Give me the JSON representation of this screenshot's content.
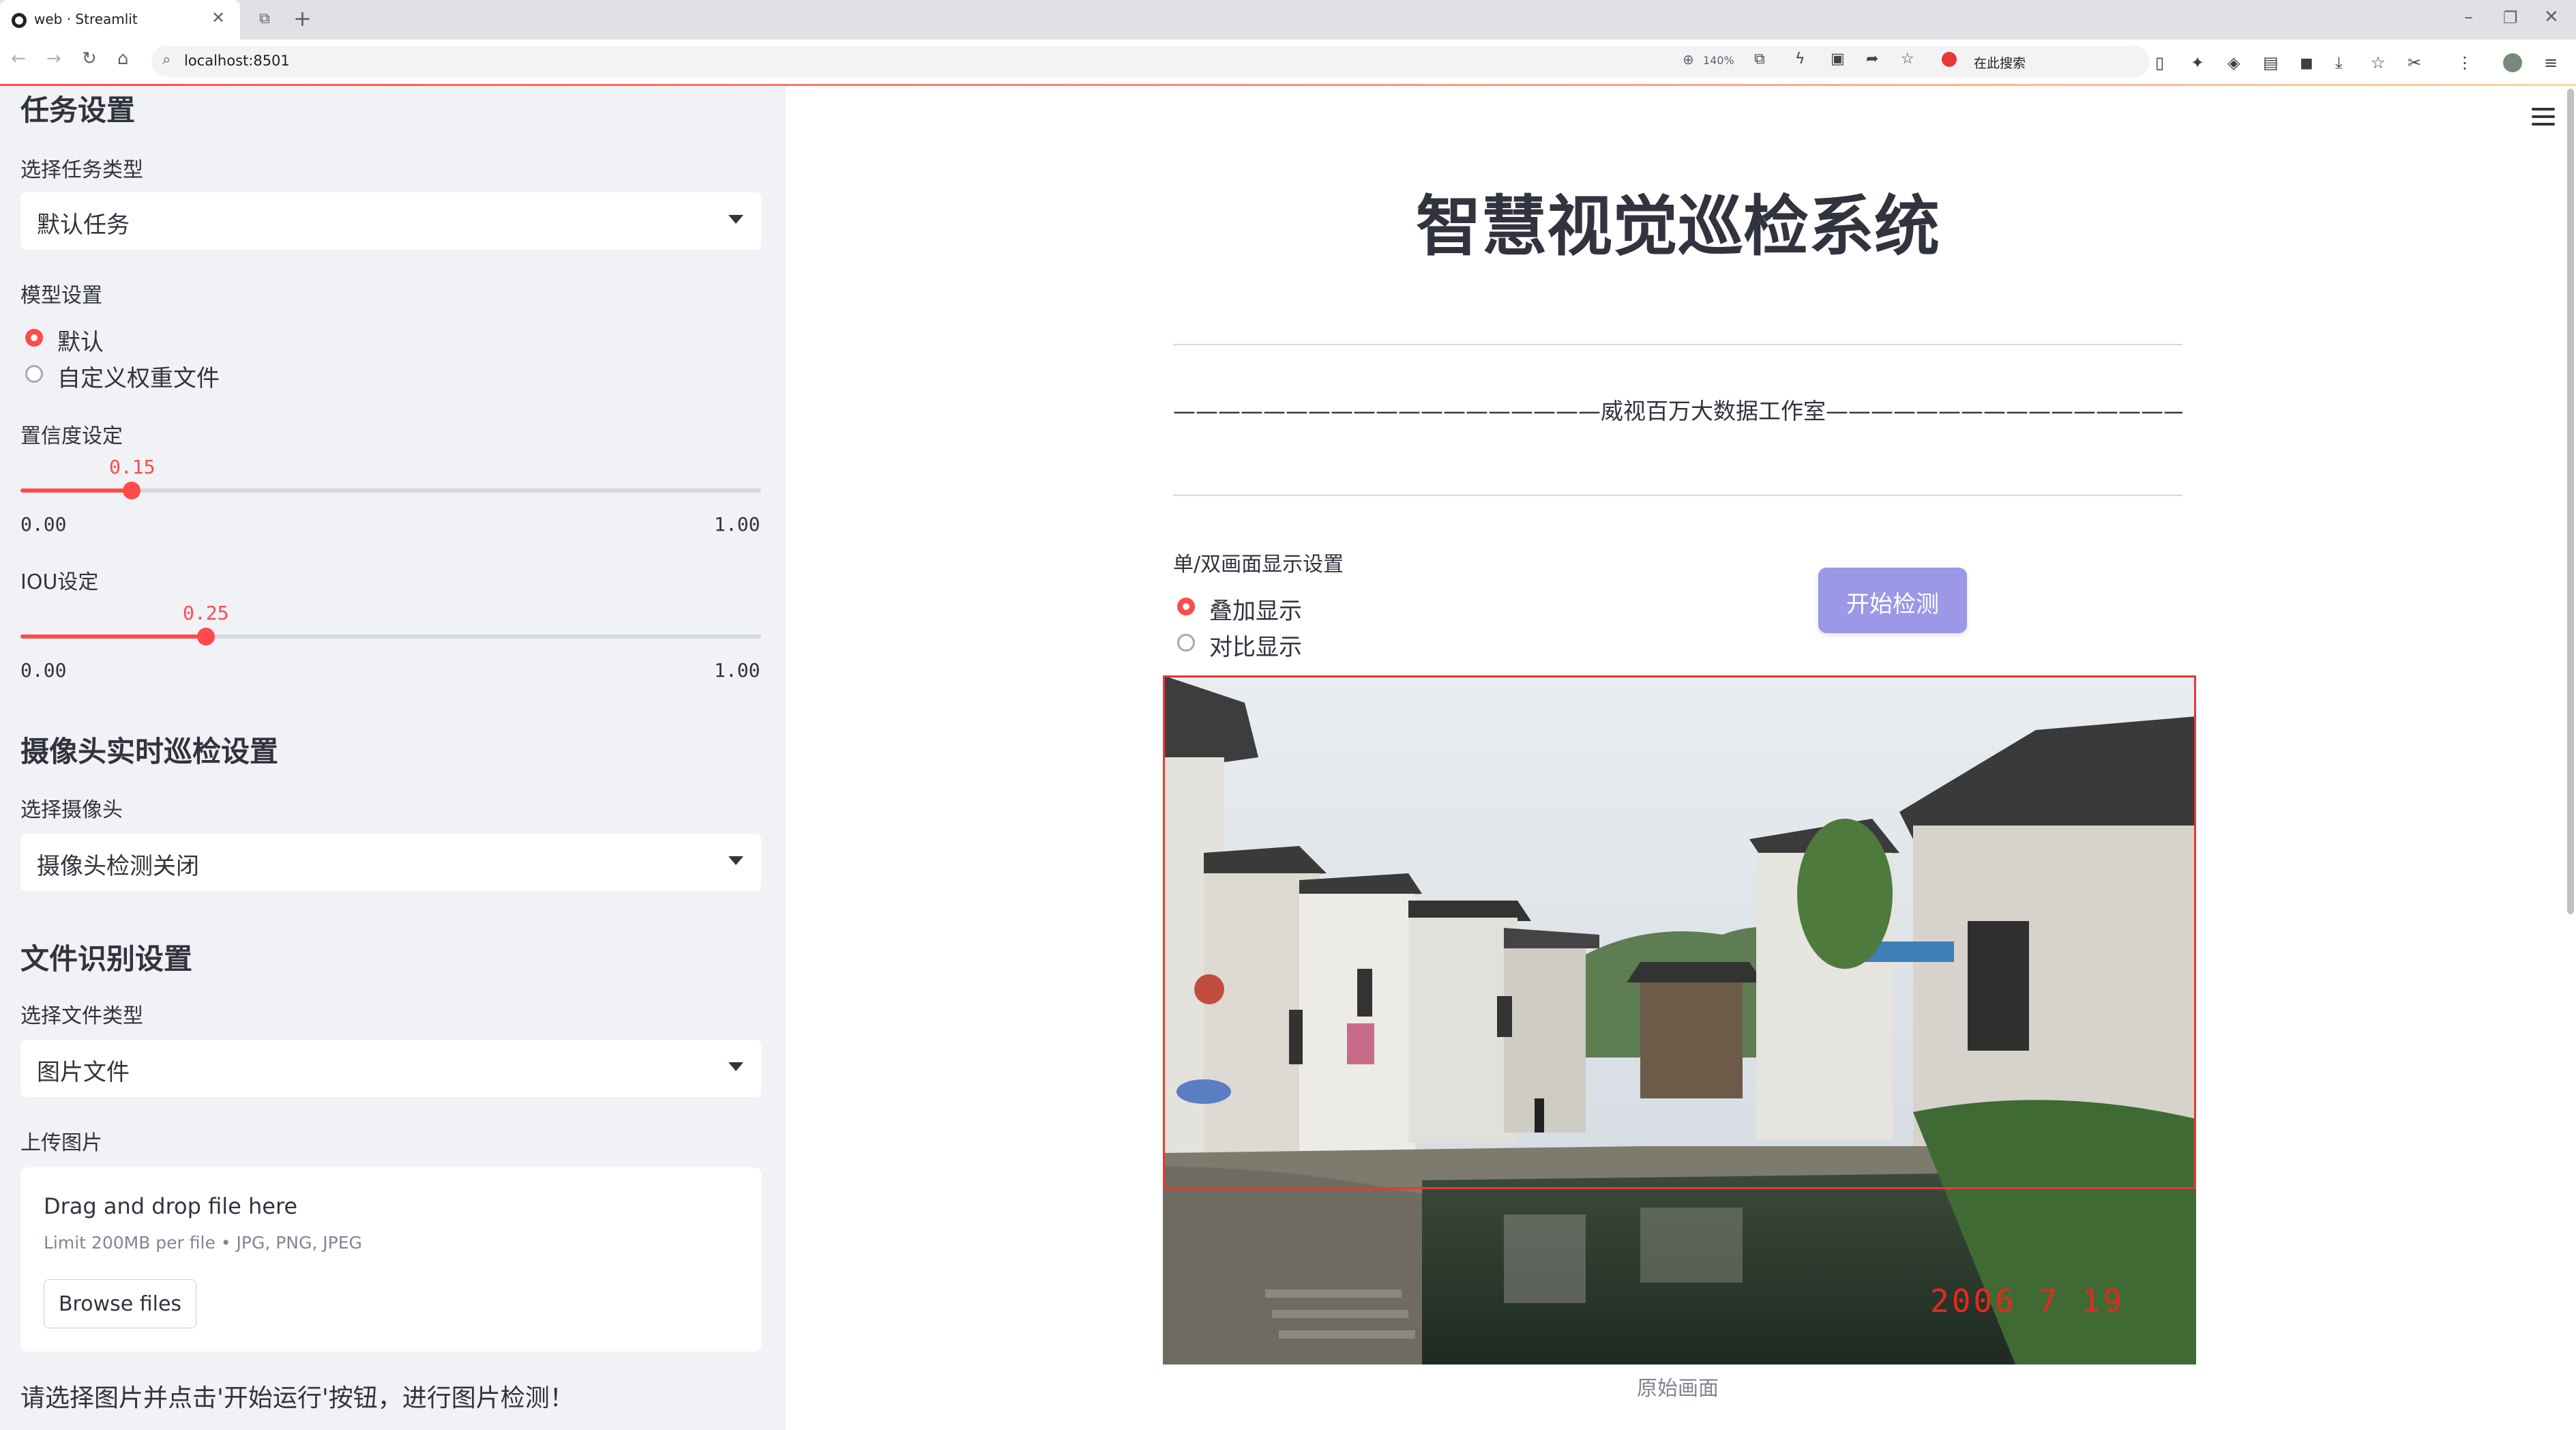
{
  "browser": {
    "tab_title": "web · Streamlit",
    "url": "localhost:8501",
    "zoom": "140%",
    "search_engine_label": "在此搜索"
  },
  "sidebar": {
    "task_section_title": "任务设置",
    "task_type_label": "选择任务类型",
    "task_type_value": "默认任务",
    "model_label": "模型设置",
    "model_options": [
      "默认",
      "自定义权重文件"
    ],
    "model_selected": "默认",
    "confidence": {
      "label": "置信度设定",
      "value": "0.15",
      "min": "0.00",
      "max": "1.00",
      "fraction": 0.15
    },
    "iou": {
      "label": "IOU设定",
      "value": "0.25",
      "min": "0.00",
      "max": "1.00",
      "fraction": 0.25
    },
    "camera_section_title": "摄像头实时巡检设置",
    "camera_label": "选择摄像头",
    "camera_value": "摄像头检测关闭",
    "file_section_title": "文件识别设置",
    "file_type_label": "选择文件类型",
    "file_type_value": "图片文件",
    "upload_label": "上传图片",
    "upload": {
      "title": "Drag and drop file here",
      "limit": "Limit 200MB per file • JPG, PNG, JPEG",
      "button": "Browse files"
    },
    "hint": "请选择图片并点击'开始运行'按钮，进行图片检测！"
  },
  "main": {
    "title": "智慧视觉巡检系统",
    "studio_line": "———————————————————威视百万大数据工作室———————————————————",
    "display_label": "单/双画面显示设置",
    "display_options": [
      "叠加显示",
      "对比显示"
    ],
    "display_selected": "叠加显示",
    "start_button": "开始检测",
    "photo_date": "2006 7 19",
    "photo_caption": "原始画面"
  },
  "colors": {
    "accent": "#ff4b4b",
    "sidebar_bg": "#f0f2f6",
    "start_button": "#9c97e6",
    "detection_box": "#e53935"
  }
}
